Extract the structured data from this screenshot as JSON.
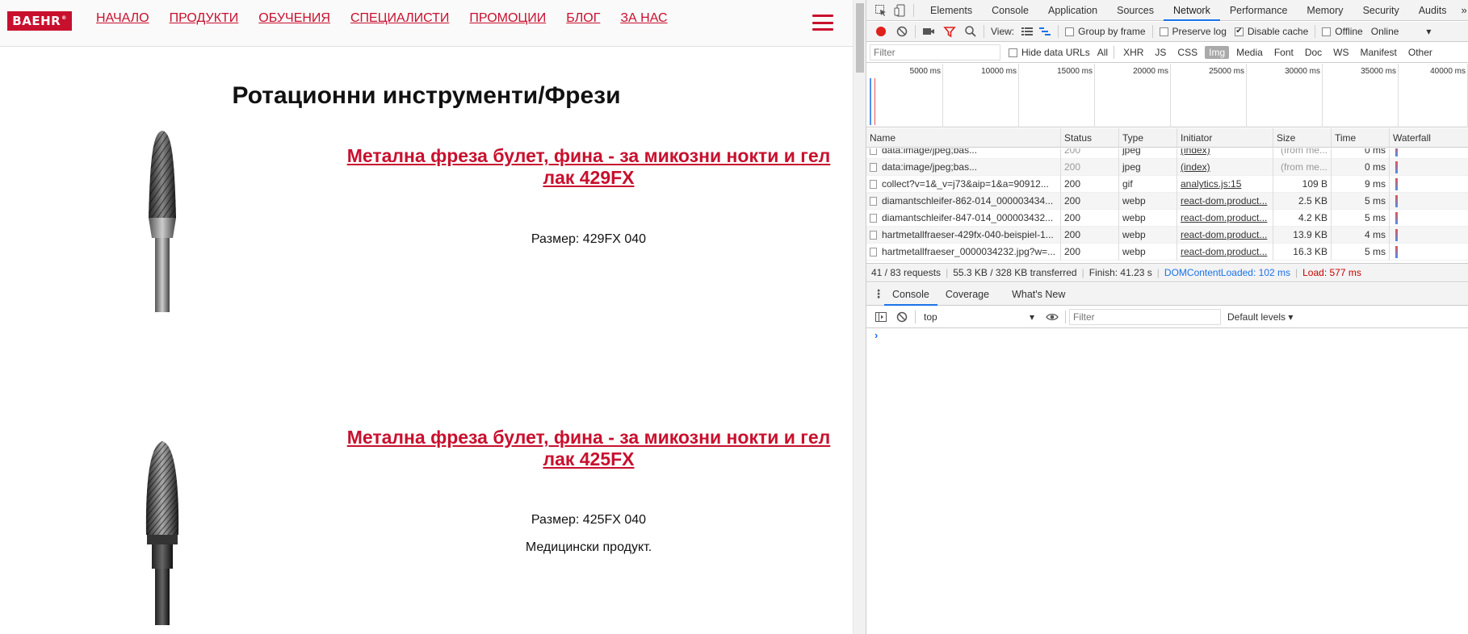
{
  "site": {
    "logo": "BAEHR",
    "logo_mark": "®",
    "nav": [
      "НАЧАЛО",
      "ПРОДУКТИ",
      "ОБУЧЕНИЯ",
      "СПЕЦИАЛИСТИ",
      "ПРОМОЦИИ",
      "БЛОГ",
      "ЗА НАС"
    ],
    "page_title": "Ротационни инструменти/Фрези",
    "products": [
      {
        "title": "Метална фреза булет, фина - за микозни нокти и гел лак 429FX",
        "size": "Размер: 429FX 040",
        "note": ""
      },
      {
        "title": "Метална фреза булет, фина - за микозни нокти и гел лак 425FX",
        "size": "Размер: 425FX 040",
        "note": "Медицински продукт."
      }
    ]
  },
  "devtools": {
    "tabs": [
      "Elements",
      "Console",
      "Application",
      "Sources",
      "Network",
      "Performance",
      "Memory",
      "Security",
      "Audits"
    ],
    "active_tab": "Network",
    "more": "»",
    "toolbar": {
      "view_label": "View:",
      "group_by_frame": "Group by frame",
      "preserve_log": "Preserve log",
      "disable_cache": "Disable cache",
      "disable_cache_checked": "✔",
      "offline": "Offline",
      "throttle": "Online"
    },
    "filter": {
      "placeholder": "Filter",
      "hide_data_urls": "Hide data URLs",
      "types": [
        "All",
        "XHR",
        "JS",
        "CSS",
        "Img",
        "Media",
        "Font",
        "Doc",
        "WS",
        "Manifest",
        "Other"
      ],
      "active_type": "Img"
    },
    "timeline_ticks": [
      "5000 ms",
      "10000 ms",
      "15000 ms",
      "20000 ms",
      "25000 ms",
      "30000 ms",
      "35000 ms",
      "40000 ms"
    ],
    "columns": [
      "Name",
      "Status",
      "Type",
      "Initiator",
      "Size",
      "Time",
      "Waterfall"
    ],
    "rows": [
      {
        "name": "data:image/jpeg;bas...",
        "status": "200",
        "type": "jpeg",
        "initiator": "(index)",
        "size": "(from me...",
        "time": "0 ms"
      },
      {
        "name": "data:image/jpeg;bas...",
        "status": "200",
        "type": "jpeg",
        "initiator": "(index)",
        "size": "(from me...",
        "time": "0 ms"
      },
      {
        "name": "collect?v=1&_v=j73&aip=1&a=90912...",
        "status": "200",
        "type": "gif",
        "initiator": "analytics.js:15",
        "size": "109 B",
        "time": "9 ms"
      },
      {
        "name": "diamantschleifer-862-014_000003434...",
        "status": "200",
        "type": "webp",
        "initiator": "react-dom.product...",
        "size": "2.5 KB",
        "time": "5 ms"
      },
      {
        "name": "diamantschleifer-847-014_000003432...",
        "status": "200",
        "type": "webp",
        "initiator": "react-dom.product...",
        "size": "4.2 KB",
        "time": "5 ms"
      },
      {
        "name": "hartmetallfraeser-429fx-040-beispiel-1...",
        "status": "200",
        "type": "webp",
        "initiator": "react-dom.product...",
        "size": "13.9 KB",
        "time": "4 ms"
      },
      {
        "name": "hartmetallfraeser_0000034232.jpg?w=...",
        "status": "200",
        "type": "webp",
        "initiator": "react-dom.product...",
        "size": "16.3 KB",
        "time": "5 ms"
      }
    ],
    "summary": {
      "requests": "41 / 83 requests",
      "transferred": "55.3 KB / 328 KB transferred",
      "finish": "Finish: 41.23 s",
      "dcl": "DOMContentLoaded: 102 ms",
      "load": "Load: 577 ms"
    },
    "drawer_tabs": [
      "Console",
      "Coverage",
      "What's New"
    ],
    "console": {
      "context": "top",
      "filter_placeholder": "Filter",
      "levels": "Default levels ▾",
      "prompt": "›"
    }
  }
}
